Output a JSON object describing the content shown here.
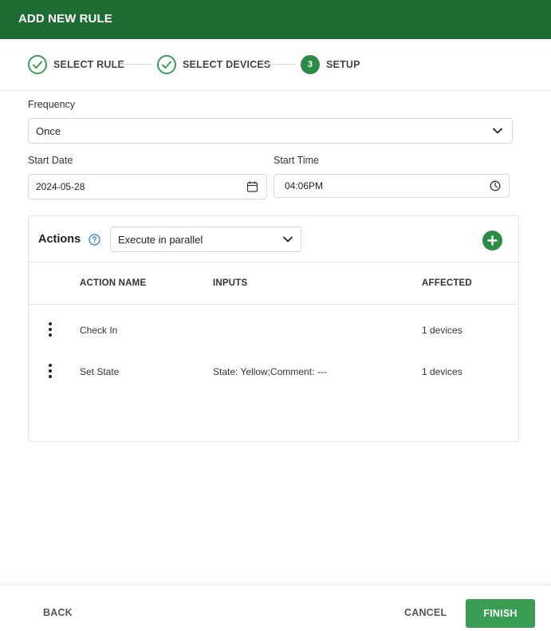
{
  "header": {
    "title": "ADD NEW RULE"
  },
  "stepper": {
    "steps": [
      {
        "label": "SELECT RULE",
        "state": "done"
      },
      {
        "label": "SELECT DEVICES",
        "state": "done"
      },
      {
        "label": "SETUP",
        "state": "active",
        "number": "3"
      }
    ]
  },
  "form": {
    "frequency": {
      "label": "Frequency",
      "value": "Once"
    },
    "start_date": {
      "label": "Start Date",
      "value": "2024-05-28"
    },
    "start_time": {
      "label": "Start Time",
      "value": "04:06PM"
    }
  },
  "actions": {
    "title": "Actions",
    "mode": "Execute in parallel",
    "columns": [
      "ACTION NAME",
      "INPUTS",
      "AFFECTED"
    ],
    "rows": [
      {
        "name": "Check In",
        "inputs": "",
        "affected": "1 devices"
      },
      {
        "name": "Set State",
        "inputs": "State: Yellow;Comment: ---",
        "affected": "1 devices"
      }
    ]
  },
  "footer": {
    "back": "BACK",
    "cancel": "CANCEL",
    "finish": "FINISH"
  },
  "colors": {
    "header_bg": "#1e6b33",
    "accent": "#2e8b47",
    "finish_bg": "#3a9d54",
    "help_icon": "#2a7fd4"
  }
}
